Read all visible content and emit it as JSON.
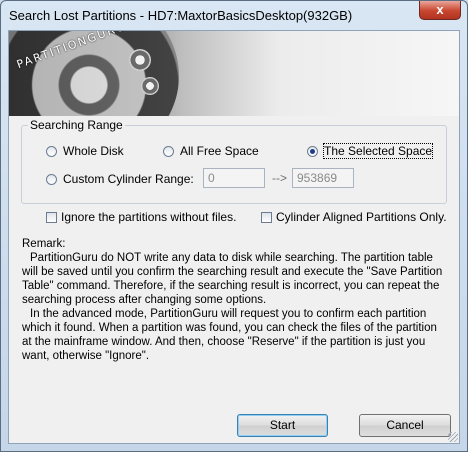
{
  "window": {
    "title": "Search Lost Partitions - HD7:MaxtorBasicsDesktop(932GB)",
    "close_glyph": "x"
  },
  "banner": {
    "brand": "PARTITIONGURU"
  },
  "searching_range": {
    "legend": "Searching Range",
    "options": [
      "Whole Disk",
      "All Free Space",
      "The Selected Space",
      "Custom Cylinder Range:"
    ],
    "selected": "The Selected Space",
    "cylinder_start": "0",
    "arrow": "-->",
    "cylinder_end": "953869"
  },
  "options": {
    "ignore_label": "Ignore the partitions without files.",
    "aligned_label": "Cylinder Aligned Partitions Only."
  },
  "remark": {
    "heading": "Remark:",
    "p1": "PartitionGuru do NOT write any data to disk while searching. The partition table will be saved until you confirm the searching result and execute the \"Save Partition Table\" command. Therefore, if the searching result is incorrect, you can repeat the searching process after changing some options.",
    "p2": "In the advanced mode, PartitionGuru will request you to confirm each partition which it found. When a partition was found, you can check the files of the partition at the mainframe window. And then, choose \"Reserve\" if the partition is just you want, otherwise \"Ignore\"."
  },
  "buttons": {
    "start": "Start",
    "cancel": "Cancel"
  }
}
